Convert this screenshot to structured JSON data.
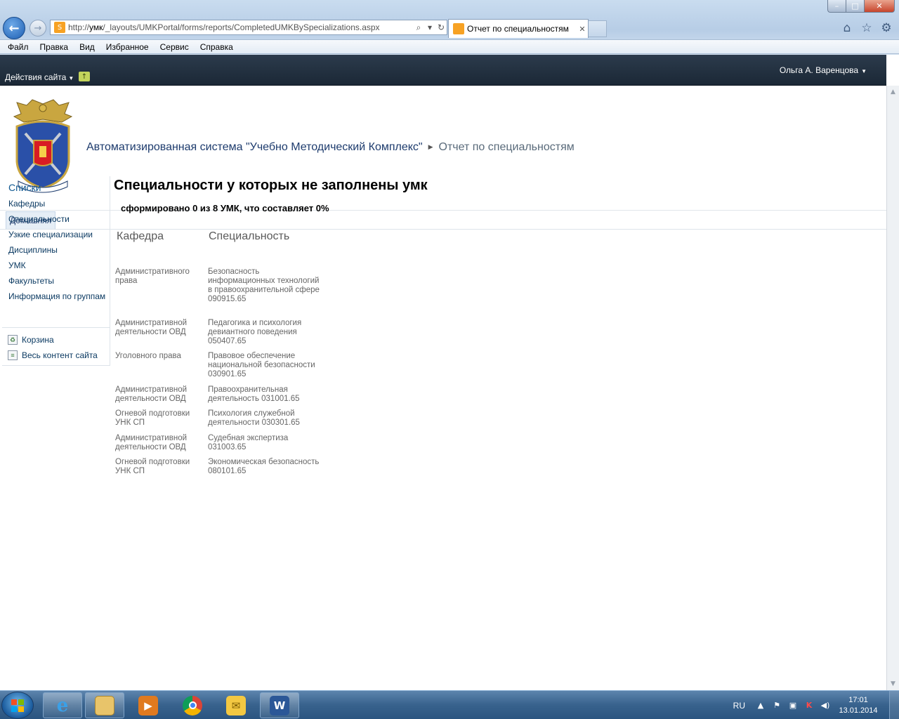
{
  "browser": {
    "address_url_prefix": "http://",
    "address_url_host": "умк",
    "address_url_path": "/_layouts/UMKPortal/forms/reports/CompletedUMKBySpecializations.aspx",
    "tab_title": "Отчет по специальностям",
    "menu": [
      "Файл",
      "Правка",
      "Вид",
      "Избранное",
      "Сервис",
      "Справка"
    ]
  },
  "ribbon": {
    "site_actions": "Действия сайта",
    "user": "Ольга А. Варенцова"
  },
  "title_area": {
    "site_title": "Автоматизированная система \"Учебно Методический Комплекс\"",
    "page_title": "Отчет по специальностям"
  },
  "topnav": {
    "home": "Домашняя"
  },
  "quicklaunch": {
    "heading": "Списки",
    "items": [
      "Кафедры",
      "Специальности",
      "Узкие специализации",
      "Дисциплины",
      "УМК",
      "Факультеты",
      "Информация по группам"
    ],
    "tools": [
      "Корзина",
      "Весь контент сайта"
    ]
  },
  "report": {
    "title": "Специальности у которых не заполнены умк",
    "summary": "сформировано 0 из 8 УМК, что составляет 0%",
    "headers": [
      "Кафедра",
      "Специальность"
    ],
    "rows": [
      [
        "Административного права",
        "Безопасность информационных технологий в правоохранительной сфере 090915.65"
      ],
      [
        "Административной деятельности ОВД",
        "Педагогика и психология девиантного поведения 050407.65"
      ],
      [
        "Уголовного права",
        "Правовое обеспечение национальной безопасности 030901.65"
      ],
      [
        "Административной деятельности ОВД",
        "Правоохранительная деятельность 031001.65"
      ],
      [
        "Огневой подготовки УНК СП",
        "Психология служебной деятельности 030301.65"
      ],
      [
        "Административной деятельности ОВД",
        "Судебная экспертиза 031003.65"
      ],
      [
        "Огневой подготовки УНК СП",
        "Экономическая безопасность 080101.65"
      ]
    ]
  },
  "taskbar": {
    "language": "RU",
    "time": "17:01",
    "date": "13.01.2014"
  }
}
